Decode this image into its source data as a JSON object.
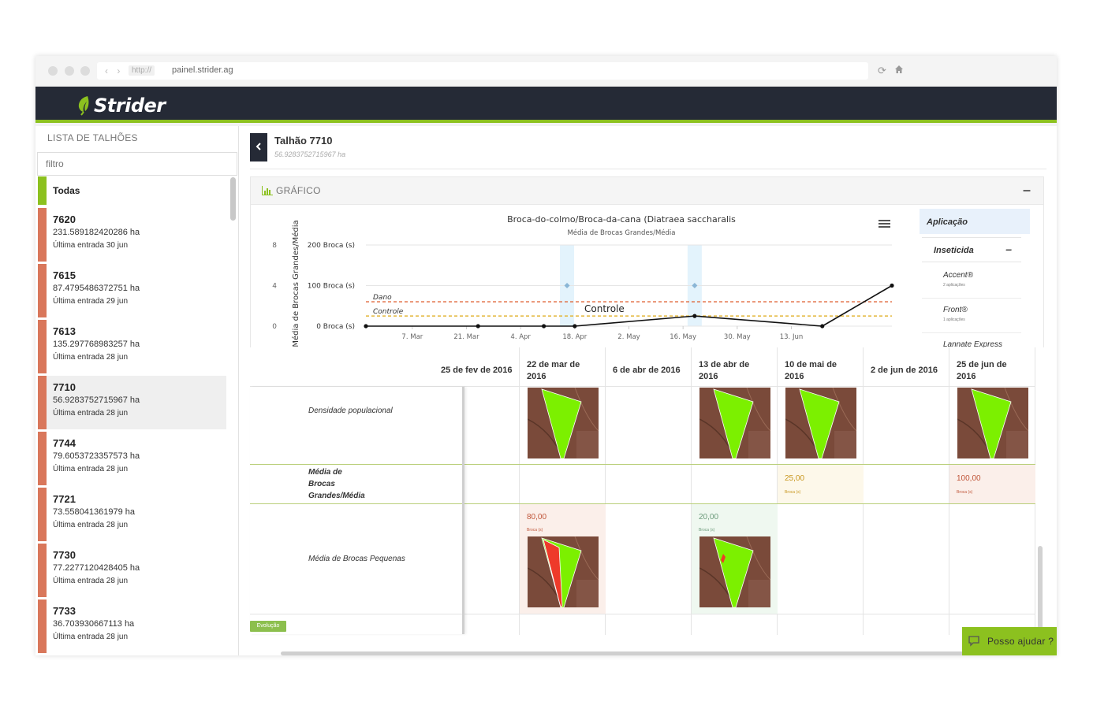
{
  "browser": {
    "url_prefix": "http://",
    "url": "painel.strider.ag"
  },
  "app": {
    "brand": "Strider",
    "brand_color": "#252a36",
    "accent_color": "#8cc11f"
  },
  "sidebar": {
    "title": "LISTA DE TALHÕES",
    "filter_placeholder": "filtro",
    "all_label": "Todas",
    "items": [
      {
        "name": "7620",
        "area": "231.589182420286 ha",
        "last": "Última entrada 30 jun"
      },
      {
        "name": "7615",
        "area": "87.4795486372751 ha",
        "last": "Última entrada 29 jun"
      },
      {
        "name": "7613",
        "area": "135.297768983257 ha",
        "last": "Última entrada 28 jun"
      },
      {
        "name": "7710",
        "area": "56.9283752715967 ha",
        "last": "Última entrada 28 jun"
      },
      {
        "name": "7744",
        "area": "79.6053723357573 ha",
        "last": "Última entrada 28 jun"
      },
      {
        "name": "7721",
        "area": "73.558041361979 ha",
        "last": "Última entrada 28 jun"
      },
      {
        "name": "7730",
        "area": "77.2277120428405 ha",
        "last": "Última entrada 28 jun"
      },
      {
        "name": "7733",
        "area": "36.703930667113 ha",
        "last": "Última entrada 28 jun"
      }
    ],
    "selected_index": 3
  },
  "plot": {
    "title": "Talhão 7710",
    "area": "56.9283752715967 ha"
  },
  "panel": {
    "title": "GRÁFICO",
    "collapse": "–"
  },
  "chart_data": {
    "type": "line",
    "title": "Broca-do-colmo/Broca-da-cana (Diatraea saccharalis",
    "subtitle": "Média de Brocas Grandes/Média",
    "ylabel": "Média de Brocas Grandes/Média",
    "left_ticks": [
      "8",
      "4",
      "0"
    ],
    "y_ticks": [
      "200 Broca (s)",
      "100 Broca (s)",
      "0 Broca (s)"
    ],
    "x_ticks": [
      "7. Mar",
      "21. Mar",
      "4. Apr",
      "18. Apr",
      "2. May",
      "16. May",
      "30. May",
      "13. Jun"
    ],
    "x_range_days": [
      -5,
      131
    ],
    "ylim": [
      0,
      200
    ],
    "series": [
      {
        "values": [
          [
            -5,
            0
          ],
          [
            24,
            0
          ],
          [
            41,
            0
          ],
          [
            49,
            0
          ],
          [
            80,
            25
          ],
          [
            113,
            0
          ],
          [
            131,
            100
          ]
        ]
      }
    ],
    "thresholds": [
      {
        "name": "Dano",
        "value": 60,
        "color": "#e0683a"
      },
      {
        "name": "Controle",
        "value": 25,
        "color": "#e3b63a"
      }
    ],
    "control_label": "Controle",
    "application_days": [
      47,
      80
    ],
    "application_point_value": 100,
    "grid": true
  },
  "application_panel": {
    "title": "Aplicação",
    "category": "Inseticida",
    "category_toggle": "–",
    "products": [
      {
        "name": "Accent®",
        "count": "2 aplicações"
      },
      {
        "name": "Front®",
        "count": "1 aplicações"
      },
      {
        "name": "Lannate Express",
        "count": ""
      }
    ]
  },
  "table": {
    "dates": [
      "25 de fev de 2016",
      "22 de mar de 2016",
      "6 de abr de 2016",
      "13 de abr de 2016",
      "10 de mai de 2016",
      "2 de jun de 2016",
      "25 de jun de 2016"
    ],
    "rows": [
      {
        "label": "Densidade populacional"
      },
      {
        "label": "Média de Brocas Grandes/Média"
      },
      {
        "label": "Média de Brocas Pequenas"
      }
    ],
    "grandes": [
      {
        "col": 4,
        "value": "25,00",
        "unit": "Broca (s)",
        "color": "#c8961e",
        "bg": "#fdf8ea"
      },
      {
        "col": 6,
        "value": "100,00",
        "unit": "Broca (s)",
        "color": "#c0563a",
        "bg": "#fbefea"
      }
    ],
    "pequenas": [
      {
        "col": 1,
        "value": "80,00",
        "unit": "Broca (s)",
        "color": "#c0563a",
        "bg": "#fbefea"
      },
      {
        "col": 3,
        "value": "20,00",
        "unit": "Broca (s)",
        "color": "#6b9a7a",
        "bg": "#eff8f0"
      }
    ],
    "evolution_button": "Evolução"
  },
  "help": {
    "label": "Posso ajudar ?"
  }
}
